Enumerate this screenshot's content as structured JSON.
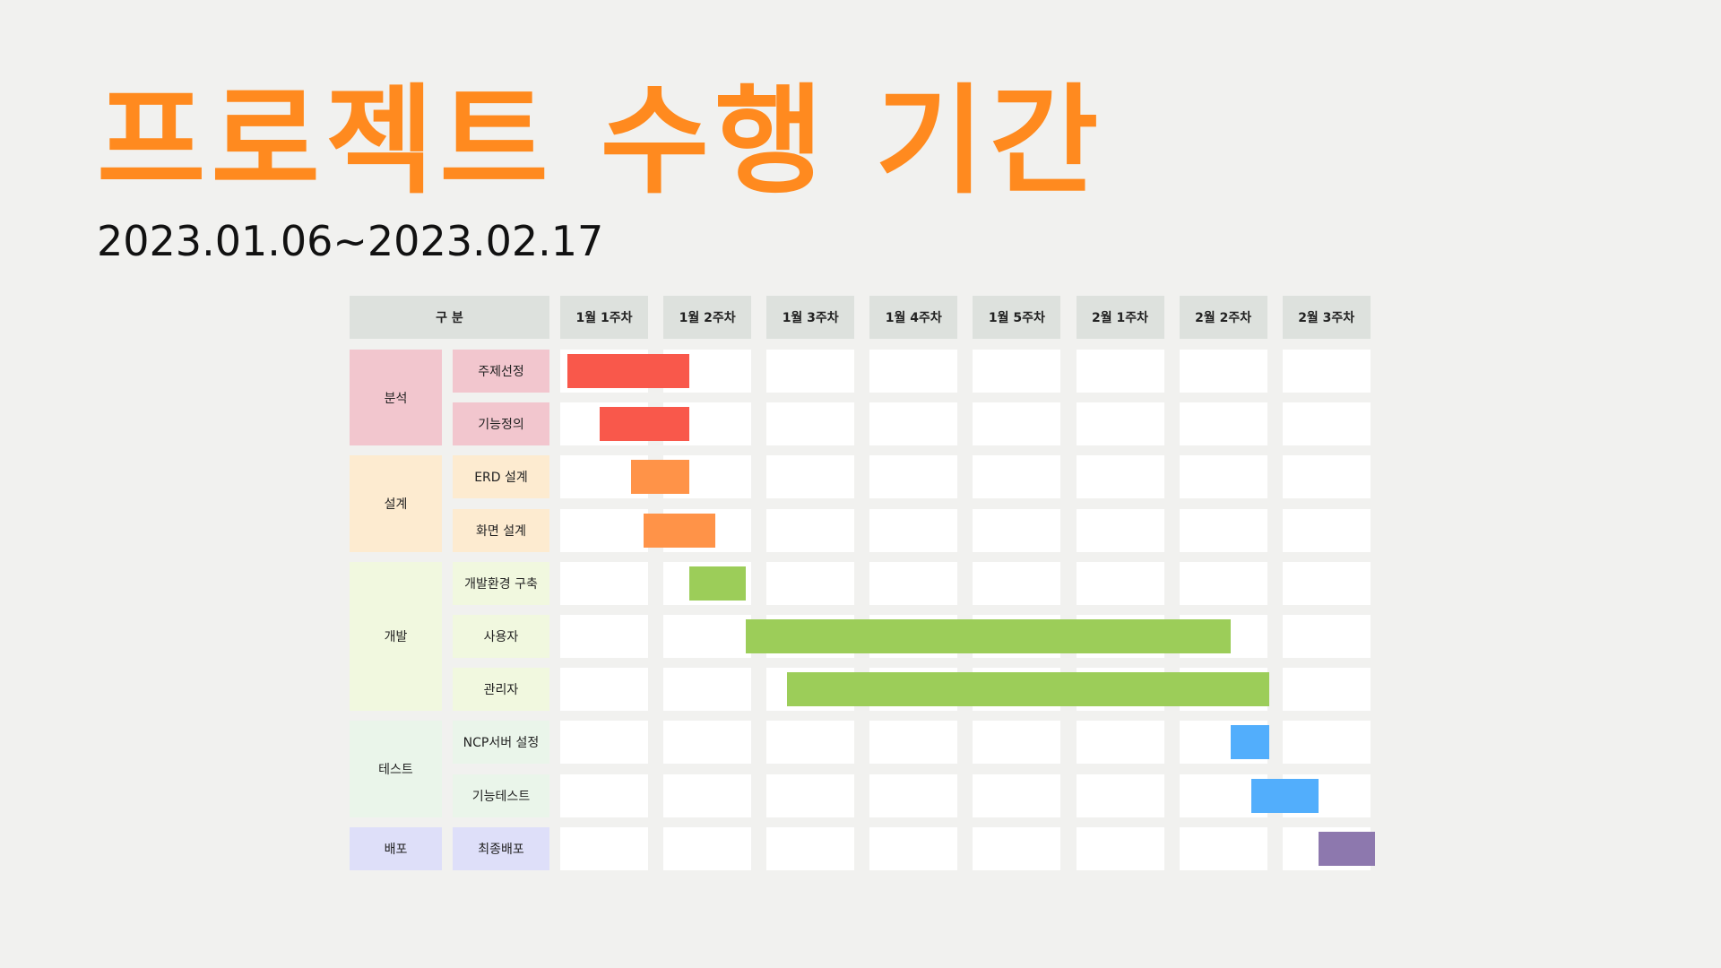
{
  "title": "프로젝트 수행 기간",
  "subtitle": "2023.01.06~2023.02.17",
  "header_label": "구  분",
  "weeks": [
    "1월 1주차",
    "1월 2주차",
    "1월 3주차",
    "1월 4주차",
    "1월 5주차",
    "2월 1주차",
    "2월 2주차",
    "2월 3주차"
  ],
  "groups": [
    {
      "name": "분석",
      "color": "#f2c6ce",
      "rows": 2
    },
    {
      "name": "설계",
      "color": "#fdebd0",
      "rows": 2
    },
    {
      "name": "개발",
      "color": "#f1f8df",
      "rows": 3
    },
    {
      "name": "테스트",
      "color": "#eaf5ea",
      "rows": 2
    },
    {
      "name": "배포",
      "color": "#dedff9",
      "rows": 1
    }
  ],
  "chart_data": {
    "type": "gantt",
    "x_unit": "week",
    "tasks": [
      {
        "name": "주제선정",
        "group": "분석",
        "start": 0.07,
        "end": 1.25,
        "color": "#f9584b"
      },
      {
        "name": "기능정의",
        "group": "분석",
        "start": 0.38,
        "end": 1.25,
        "color": "#f9584b"
      },
      {
        "name": "ERD 설계",
        "group": "설계",
        "start": 0.69,
        "end": 1.25,
        "color": "#ff9348"
      },
      {
        "name": "화면 설계",
        "group": "설계",
        "start": 0.81,
        "end": 1.5,
        "color": "#ff9348"
      },
      {
        "name": "개발환경 구축",
        "group": "개발",
        "start": 1.25,
        "end": 1.8,
        "color": "#9ccd59"
      },
      {
        "name": "사용자",
        "group": "개발",
        "start": 1.8,
        "end": 6.5,
        "color": "#9ccd59"
      },
      {
        "name": "관리자",
        "group": "개발",
        "start": 2.2,
        "end": 6.87,
        "color": "#9ccd59"
      },
      {
        "name": "NCP서버 설정",
        "group": "테스트",
        "start": 6.5,
        "end": 6.87,
        "color": "#52aefc"
      },
      {
        "name": "기능테스트",
        "group": "테스트",
        "start": 6.7,
        "end": 7.35,
        "color": "#52aefc"
      },
      {
        "name": "최종배포",
        "group": "배포",
        "start": 7.35,
        "end": 7.9,
        "color": "#8d78ae"
      }
    ]
  }
}
